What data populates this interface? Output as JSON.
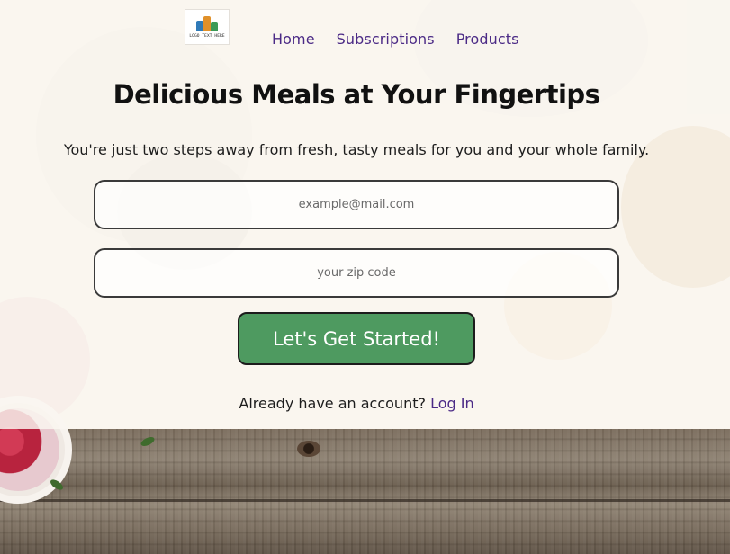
{
  "logo": {
    "text": "LOGO TEXT HERE",
    "icon": "logo-icon"
  },
  "nav": {
    "items": [
      {
        "label": "Home"
      },
      {
        "label": "Subscriptions"
      },
      {
        "label": "Products"
      }
    ]
  },
  "hero": {
    "headline": "Delicious Meals at Your Fingertips",
    "subhead": "You're just two steps away from fresh, tasty meals for you and your whole family."
  },
  "form": {
    "email_placeholder": "example@mail.com",
    "email_value": "",
    "zip_placeholder": "your zip code",
    "zip_value": "",
    "submit_label": "Let's Get Started!"
  },
  "login": {
    "prompt": "Already have an account?",
    "link_label": "Log In"
  },
  "colors": {
    "nav_link": "#4b2a86",
    "cta_background": "#4e9a60",
    "headline": "#111111"
  }
}
